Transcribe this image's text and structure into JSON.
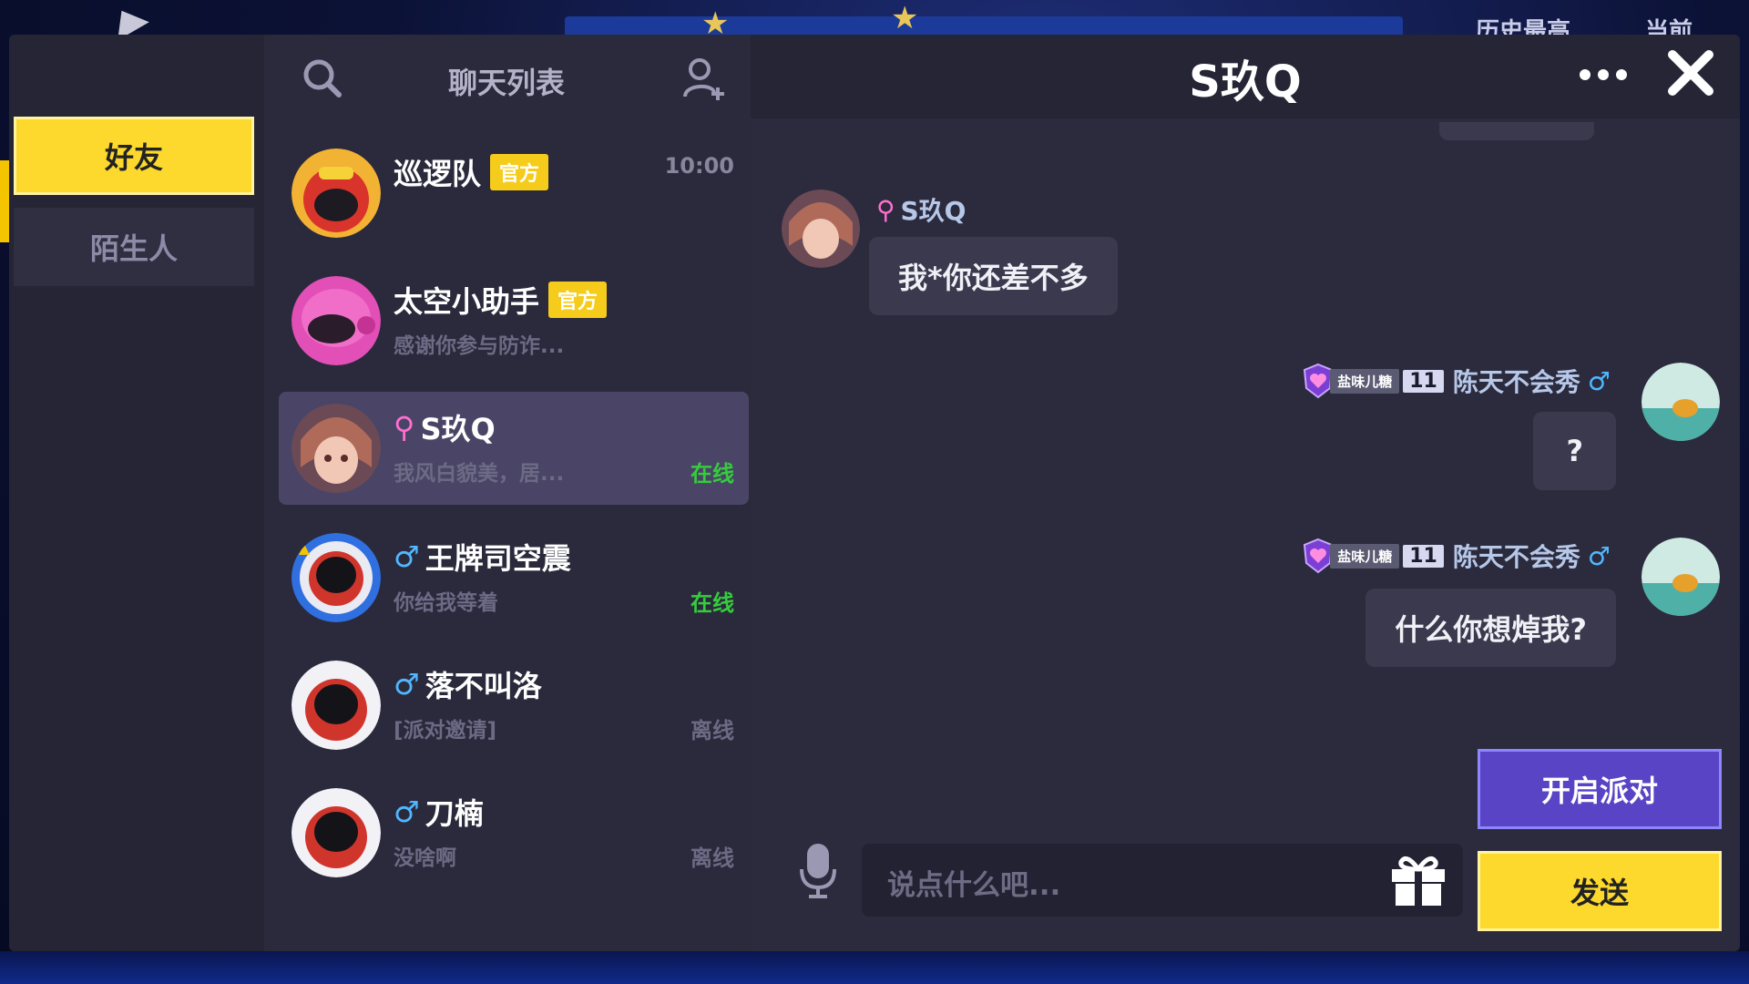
{
  "background": {
    "top_text_1": "历史最高",
    "top_text_2": "当前"
  },
  "tabs": {
    "friends": "好友",
    "strangers": "陌生人"
  },
  "chat_list": {
    "title": "聊天列表",
    "items": [
      {
        "name": "巡逻队",
        "badge": "官方",
        "preview": "",
        "time": "10:00",
        "status": "",
        "gender": ""
      },
      {
        "name": "太空小助手",
        "badge": "官方",
        "preview": "感谢你参与防诈...",
        "time": "",
        "status": "",
        "gender": ""
      },
      {
        "name": "S玖Q",
        "badge": "",
        "preview": "我风白貌美，居...",
        "time": "",
        "status": "在线",
        "gender": "female"
      },
      {
        "name": "王牌司空震",
        "badge": "",
        "preview": "你给我等着",
        "time": "",
        "status": "在线",
        "gender": "male"
      },
      {
        "name": "落不叫洛",
        "badge": "",
        "preview": "[派对邀请]",
        "time": "",
        "status": "离线",
        "gender": "male"
      },
      {
        "name": "刀楠",
        "badge": "",
        "preview": "没啥啊",
        "time": "",
        "status": "离线",
        "gender": "male"
      }
    ]
  },
  "chat": {
    "title": "S玖Q",
    "messages": [
      {
        "sender": "S玖Q",
        "side": "left",
        "text": "我*你还差不多"
      },
      {
        "sender": "陈天不会秀",
        "level_label": "盐味儿糖",
        "level": "11",
        "side": "right",
        "text": "?"
      },
      {
        "sender": "陈天不会秀",
        "level_label": "盐味儿糖",
        "level": "11",
        "side": "right",
        "text": "什么你想焯我?"
      }
    ],
    "input_placeholder": "说点什么吧...",
    "party_button": "开启派对",
    "send_button": "发送"
  },
  "colors": {
    "accent_yellow": "#fcd92c",
    "party_purple": "#5944c5",
    "online_green": "#35cc3d"
  },
  "icons": {
    "search": "search-icon",
    "add_friend": "add-friend-icon",
    "more": "more-icon",
    "close": "close-icon",
    "mic": "microphone-icon",
    "gift": "gift-icon"
  }
}
